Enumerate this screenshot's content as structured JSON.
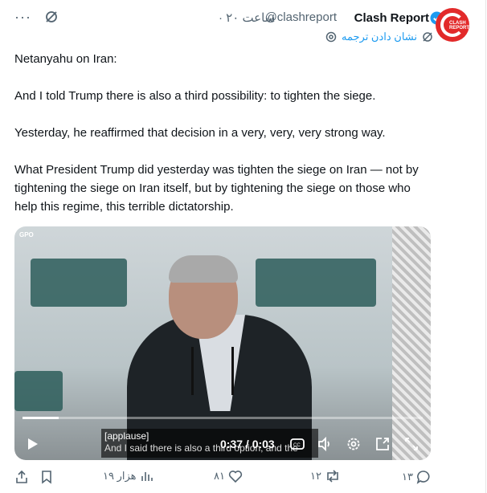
{
  "header": {
    "name": "Clash Report",
    "handle": "@clashreport",
    "time": "· ۲۰ ساعت",
    "translate_label": "نشان دادن ترجمه",
    "avatar_text": "CLASH REPORT"
  },
  "post": {
    "paragraphs": [
      "Netanyahu on Iran:",
      "And I told Trump there is also a third possibility: to tighten the siege.",
      "Yesterday, he reaffirmed that decision in a very, very, very strong way.",
      "What President Trump did yesterday was tighten the siege on Iran — not by tightening the siege on Iran itself, but by tightening the siege on those who help this regime, this terrible dictatorship."
    ]
  },
  "video": {
    "watermark": "GPO",
    "caption_line1": "[applause]",
    "caption_line2": "And I said there is also a third option, and the",
    "time": "0:37 / 0:03",
    "progress": 0.09
  },
  "actions": {
    "views": "۱۹ هزار",
    "likes": "۸۱",
    "reposts": "۱۲",
    "replies": "۱۳"
  },
  "colors": {
    "accent": "#1d9bf0",
    "muted": "#536471",
    "brand": "#e22a2a"
  }
}
